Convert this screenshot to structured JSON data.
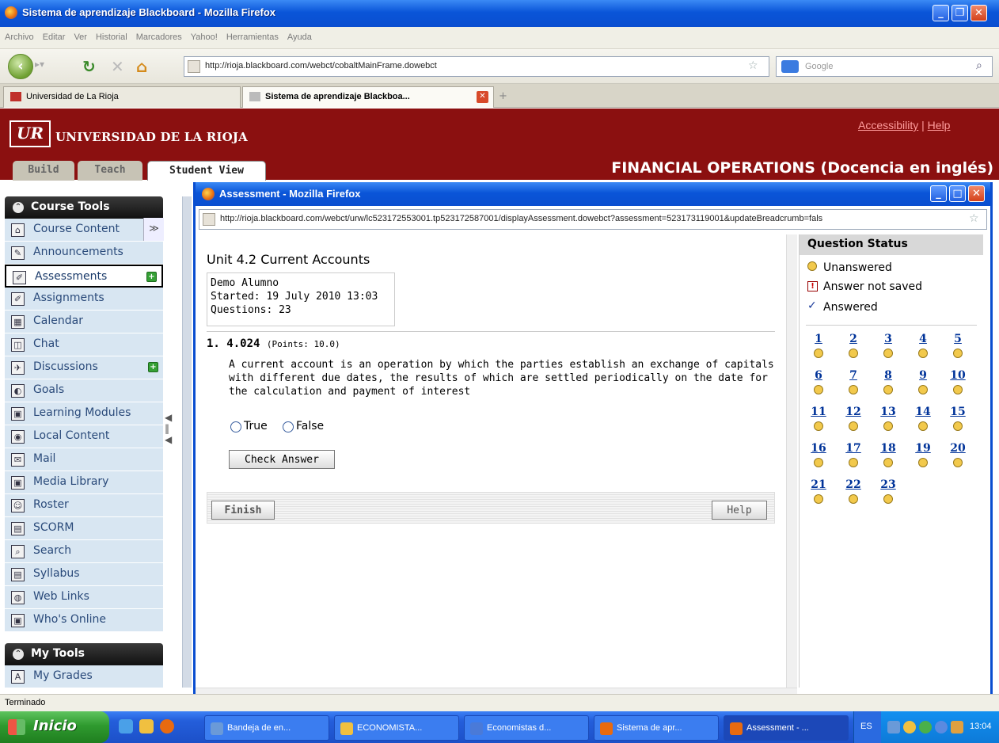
{
  "browser": {
    "title": "Sistema de aprendizaje Blackboard - Mozilla Firefox",
    "menu": [
      "Archivo",
      "Editar",
      "Ver",
      "Historial",
      "Marcadores",
      "Yahoo!",
      "Herramientas",
      "Ayuda"
    ],
    "url": "http://rioja.blackboard.com/webct/cobaltMainFrame.dowebct",
    "search_placeholder": "Google",
    "tabs": [
      "Universidad de La Rioja",
      "Sistema de aprendizaje Blackboa..."
    ]
  },
  "header": {
    "logo_text": "UR",
    "university": "UNIVERSIDAD DE LA RIOJA",
    "accessibility": "Accessibility",
    "separator": "|",
    "help": "Help",
    "course_title": "FINANCIAL OPERATIONS (Docencia en inglés)",
    "mode_tabs": [
      "Build",
      "Teach",
      "Student View"
    ]
  },
  "sidebar": {
    "course_tools": "Course Tools",
    "items": [
      {
        "label": "Course Content",
        "icon": "home-icon"
      },
      {
        "label": "Announcements",
        "icon": "megaphone-icon"
      },
      {
        "label": "Assessments",
        "icon": "assessment-icon"
      },
      {
        "label": "Assignments",
        "icon": "assignment-icon"
      },
      {
        "label": "Calendar",
        "icon": "calendar-icon"
      },
      {
        "label": "Chat",
        "icon": "chat-icon"
      },
      {
        "label": "Discussions",
        "icon": "discussion-icon"
      },
      {
        "label": "Goals",
        "icon": "goals-icon"
      },
      {
        "label": "Learning Modules",
        "icon": "module-icon"
      },
      {
        "label": "Local Content",
        "icon": "local-content-icon"
      },
      {
        "label": "Mail",
        "icon": "mail-icon"
      },
      {
        "label": "Media Library",
        "icon": "media-icon"
      },
      {
        "label": "Roster",
        "icon": "roster-icon"
      },
      {
        "label": "SCORM",
        "icon": "scorm-icon"
      },
      {
        "label": "Search",
        "icon": "search-icon"
      },
      {
        "label": "Syllabus",
        "icon": "syllabus-icon"
      },
      {
        "label": "Web Links",
        "icon": "web-links-icon"
      },
      {
        "label": "Who's Online",
        "icon": "online-icon"
      }
    ],
    "my_tools": "My Tools",
    "my_items": [
      {
        "label": "My Grades",
        "icon": "grades-icon"
      }
    ]
  },
  "popup": {
    "title": "Assessment - Mozilla Firefox",
    "url": "http://rioja.blackboard.com/webct/urw/lc523172553001.tp523172587001/displayAssessment.dowebct?assessment=523173119001&updateBreadcrumb=fals",
    "assessment_title": "Unit 4.2 Current Accounts",
    "student": "Demo Alumno",
    "started": "Started: 19 July 2010 13:03",
    "questions": "Questions: 23",
    "question": {
      "number": "1. 4.024",
      "points": "(Points: 10.0)",
      "text": "A current account is an operation by which the parties establish an exchange of capitals with different due dates, the results of which are settled periodically on the date for the calculation and payment of interest",
      "option_true": "True",
      "option_false": "False",
      "check_button": "Check Answer"
    },
    "finish_button": "Finish",
    "help_button": "Help",
    "status": {
      "title": "Question Status",
      "unanswered": "Unanswered",
      "not_saved": "Answer not saved",
      "answered": "Answered",
      "numbers": [
        "1",
        "2",
        "3",
        "4",
        "5",
        "6",
        "7",
        "8",
        "9",
        "10",
        "11",
        "12",
        "13",
        "14",
        "15",
        "16",
        "17",
        "18",
        "19",
        "20",
        "21",
        "22",
        "23"
      ]
    }
  },
  "statusbar": {
    "text": "Terminado"
  },
  "taskbar": {
    "start": "Inicio",
    "tasks": [
      "Bandeja de en...",
      "ECONOMISTA...",
      "Economistas d...",
      "Sistema de apr...",
      "Assessment - ..."
    ],
    "lang": "ES",
    "time": "13:04"
  },
  "colors": {
    "header_red": "#8b1010",
    "sidebar_blue": "#d8e6f2",
    "link_blue": "#003399"
  }
}
